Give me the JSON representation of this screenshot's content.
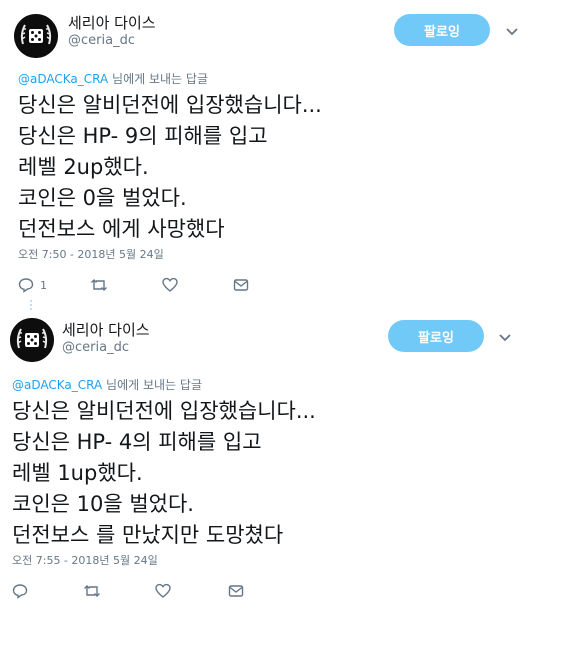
{
  "colors": {
    "accent": "#1da1f2",
    "follow_button_bg": "#71c9f8",
    "secondary_text": "#657786"
  },
  "tweets": [
    {
      "display_name": "세리아 다이스",
      "handle": "@ceria_dc",
      "follow_label": "팔로잉",
      "reply_mention": "@aDACKa_CRA",
      "reply_suffix": " 님에게 보내는 답글",
      "body": "당신은 알비던전에 입장했습니다...\n당신은 HP- 9의 피해를 입고\n레벨 2up했다.\n코인은 0을 벌었다.\n던전보스 에게 사망했다",
      "timestamp": "오전 7:50 - 2018년 5월 24일",
      "reply_count": "1",
      "icons": [
        "reply-icon",
        "retweet-icon",
        "like-icon",
        "message-icon"
      ]
    },
    {
      "display_name": "세리아 다이스",
      "handle": "@ceria_dc",
      "follow_label": "팔로잉",
      "reply_mention": "@aDACKa_CRA",
      "reply_suffix": " 님에게 보내는 답글",
      "body": "당신은 알비던전에 입장했습니다...\n당신은 HP- 4의 피해를 입고\n레벨 1up했다.\n코인은 10을 벌었다.\n던전보스 를 만났지만 도망쳤다",
      "timestamp": "오전 7:55 - 2018년 5월 24일",
      "reply_count": "",
      "icons": [
        "reply-icon",
        "retweet-icon",
        "like-icon",
        "message-icon"
      ]
    }
  ]
}
